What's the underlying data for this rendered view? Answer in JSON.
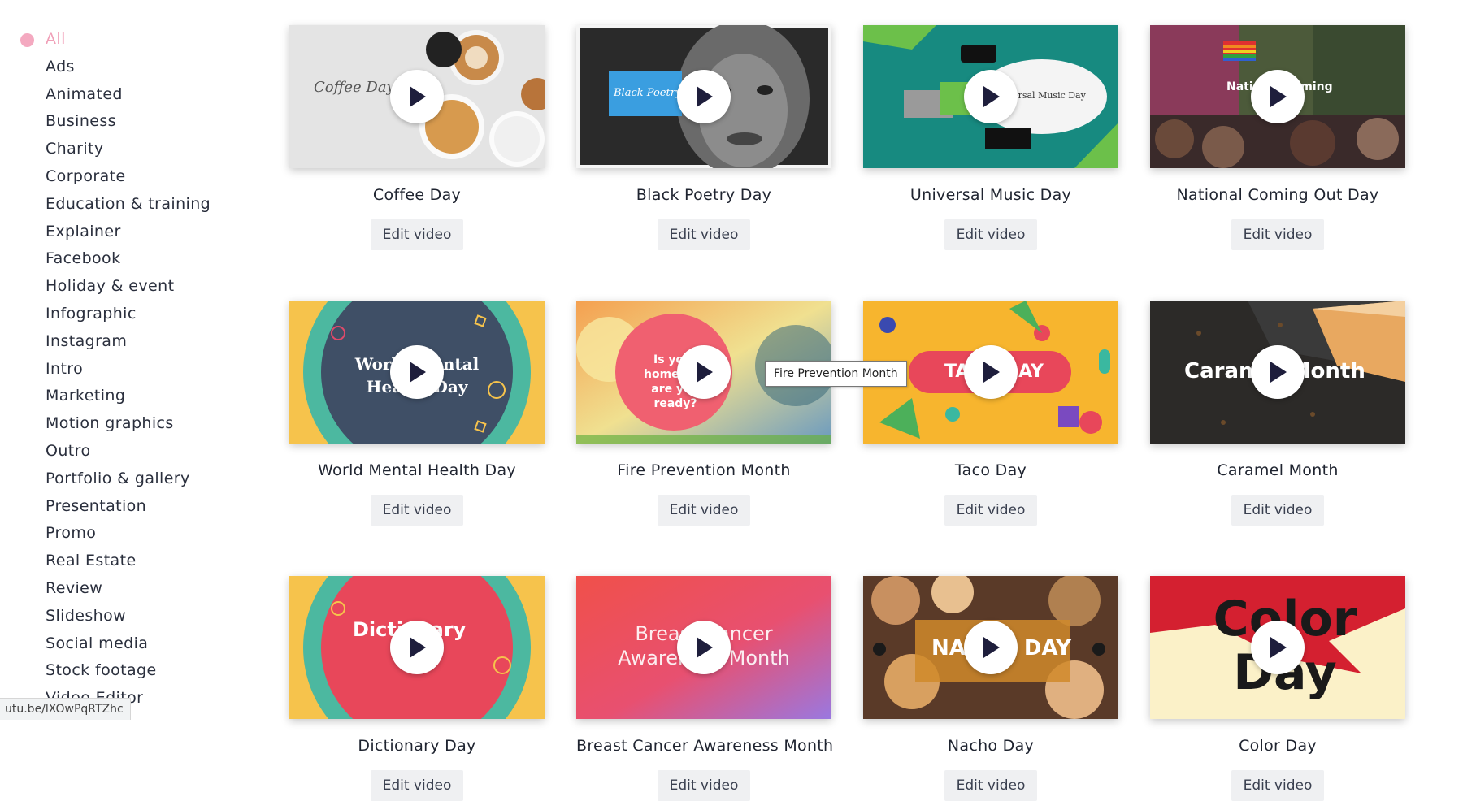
{
  "sidebar": {
    "categories": [
      "All",
      "Ads",
      "Animated",
      "Business",
      "Charity",
      "Corporate",
      "Education & training",
      "Explainer",
      "Facebook",
      "Holiday & event",
      "Infographic",
      "Instagram",
      "Intro",
      "Marketing",
      "Motion graphics",
      "Outro",
      "Portfolio & gallery",
      "Presentation",
      "Promo",
      "Real Estate",
      "Review",
      "Slideshow",
      "Social media",
      "Stock footage",
      "Video Editor"
    ],
    "active": "All"
  },
  "status_url": "utu.be/lXOwPqRTZhc",
  "hover_tooltip": "Fire Prevention Month",
  "edit_label": "Edit video",
  "cards": [
    {
      "title": "Coffee Day",
      "thumb_text": "Coffee Day"
    },
    {
      "title": "Black Poetry Day",
      "thumb_text": "Black Poetry"
    },
    {
      "title": "Universal Music Day",
      "thumb_text": "Universal Music Day"
    },
    {
      "title": "National Coming Out Day",
      "thumb_text": "National Coming"
    },
    {
      "title": "World Mental Health Day",
      "thumb_text": "World Mental Health Day"
    },
    {
      "title": "Fire Prevention Month",
      "thumb_text": "Is your home and are you ready?"
    },
    {
      "title": "Taco Day",
      "thumb_text": "TACO DAY"
    },
    {
      "title": "Caramel Month",
      "thumb_text": "Caramel Month"
    },
    {
      "title": "Dictionary Day",
      "thumb_text": "Dictionary"
    },
    {
      "title": "Breast Cancer Awareness Month",
      "thumb_text": "Breast Cancer Awareness Month"
    },
    {
      "title": "Nacho Day",
      "thumb_text": "NACHO DAY"
    },
    {
      "title": "Color Day",
      "thumb_text": "Color Day"
    }
  ],
  "colors": {
    "accent_pink": "#f4a9c0",
    "button_bg": "#eff0f2",
    "text": "#1f2430"
  }
}
